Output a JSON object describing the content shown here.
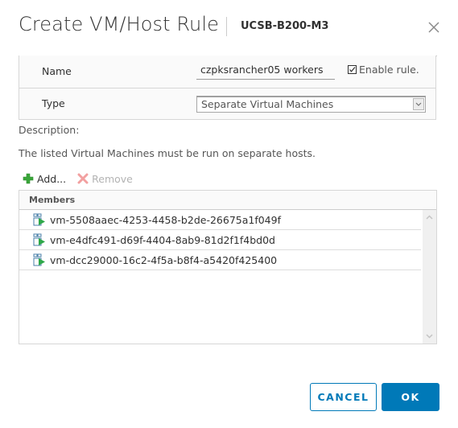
{
  "dialog": {
    "title": "Create VM/Host Rule",
    "subtitle": "UCSB-B200-M3"
  },
  "form": {
    "name_label": "Name",
    "name_value": "czpksrancher05 workers",
    "enable_rule_label": "Enable rule.",
    "enable_rule_checked": true,
    "type_label": "Type",
    "type_selected": "Separate Virtual Machines"
  },
  "description": {
    "label": "Description:",
    "text": "The listed Virtual Machines must be run on separate hosts."
  },
  "toolbar": {
    "add_label": "Add...",
    "remove_label": "Remove"
  },
  "members": {
    "header": "Members",
    "rows": [
      {
        "name": "vm-5508aaec-4253-4458-b2de-26675a1f049f"
      },
      {
        "name": "vm-e4dfc491-d69f-4404-8ab9-81d2f1f4bd0d"
      },
      {
        "name": "vm-dcc29000-16c2-4f5a-b8f4-a5420f425400"
      }
    ]
  },
  "footer": {
    "cancel_label": "CANCEL",
    "ok_label": "OK"
  },
  "colors": {
    "primary": "#0079b8",
    "add_icon": "#2e9c2e",
    "remove_icon": "#f2a0a0"
  }
}
